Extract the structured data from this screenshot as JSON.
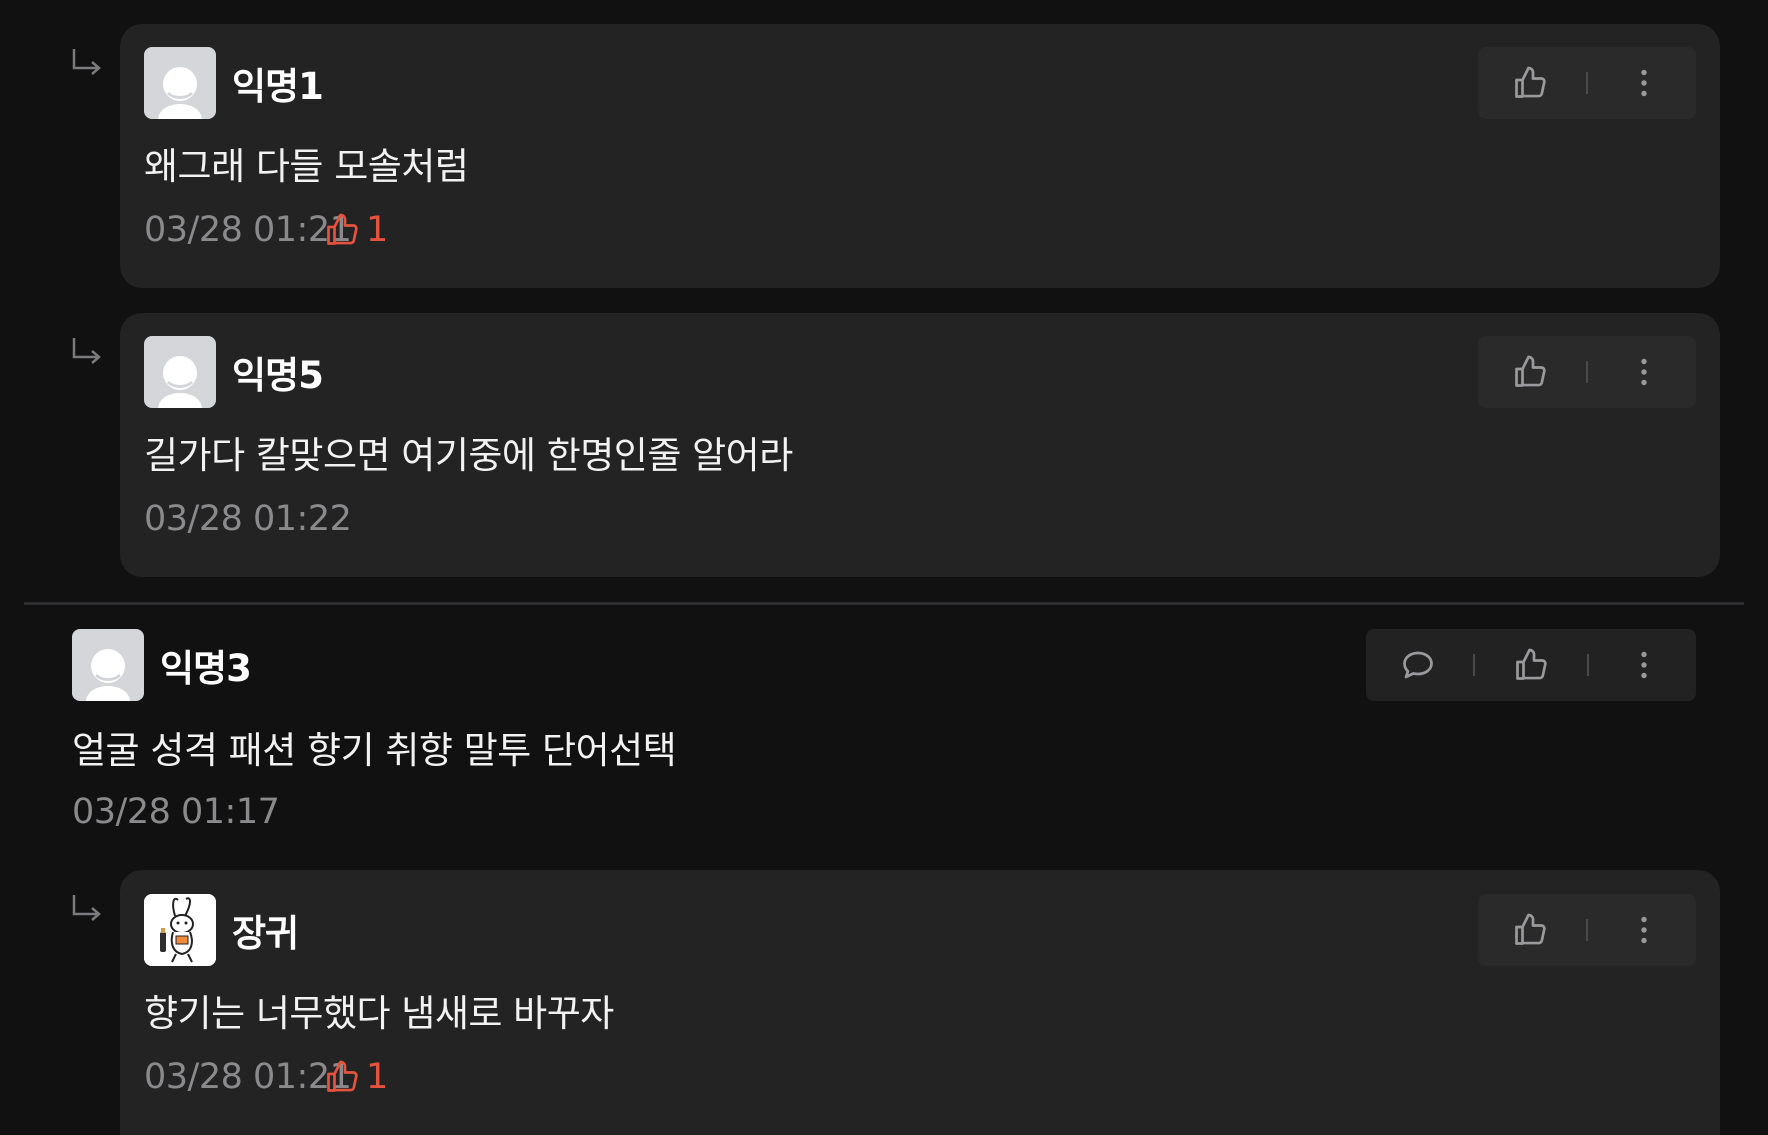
{
  "colors": {
    "background": "#111112",
    "card": "#232324",
    "like_accent": "#e5533e",
    "muted_text": "#8a8a8d"
  },
  "comments": [
    {
      "type": "reply",
      "author": "익명1",
      "avatar": "default-avatar",
      "text": "왜그래 다들 모솔처럼",
      "time": "03/28 01:21",
      "likes": "1"
    },
    {
      "type": "reply",
      "author": "익명5",
      "avatar": "default-avatar",
      "text": "길가다 칼맞으면 여기중에 한명인줄 알어라",
      "time": "03/28 01:22"
    },
    {
      "type": "comment",
      "author": "익명3",
      "avatar": "default-avatar",
      "text": "얼굴 성격 패션 향기 취향 말투 단어선택",
      "time": "03/28 01:17"
    },
    {
      "type": "reply",
      "author": "장귀",
      "avatar": "bunny-avatar",
      "text": "향기는 너무했다 냄새로 바꾸자",
      "time": "03/28 01:21",
      "likes": "1"
    }
  ]
}
